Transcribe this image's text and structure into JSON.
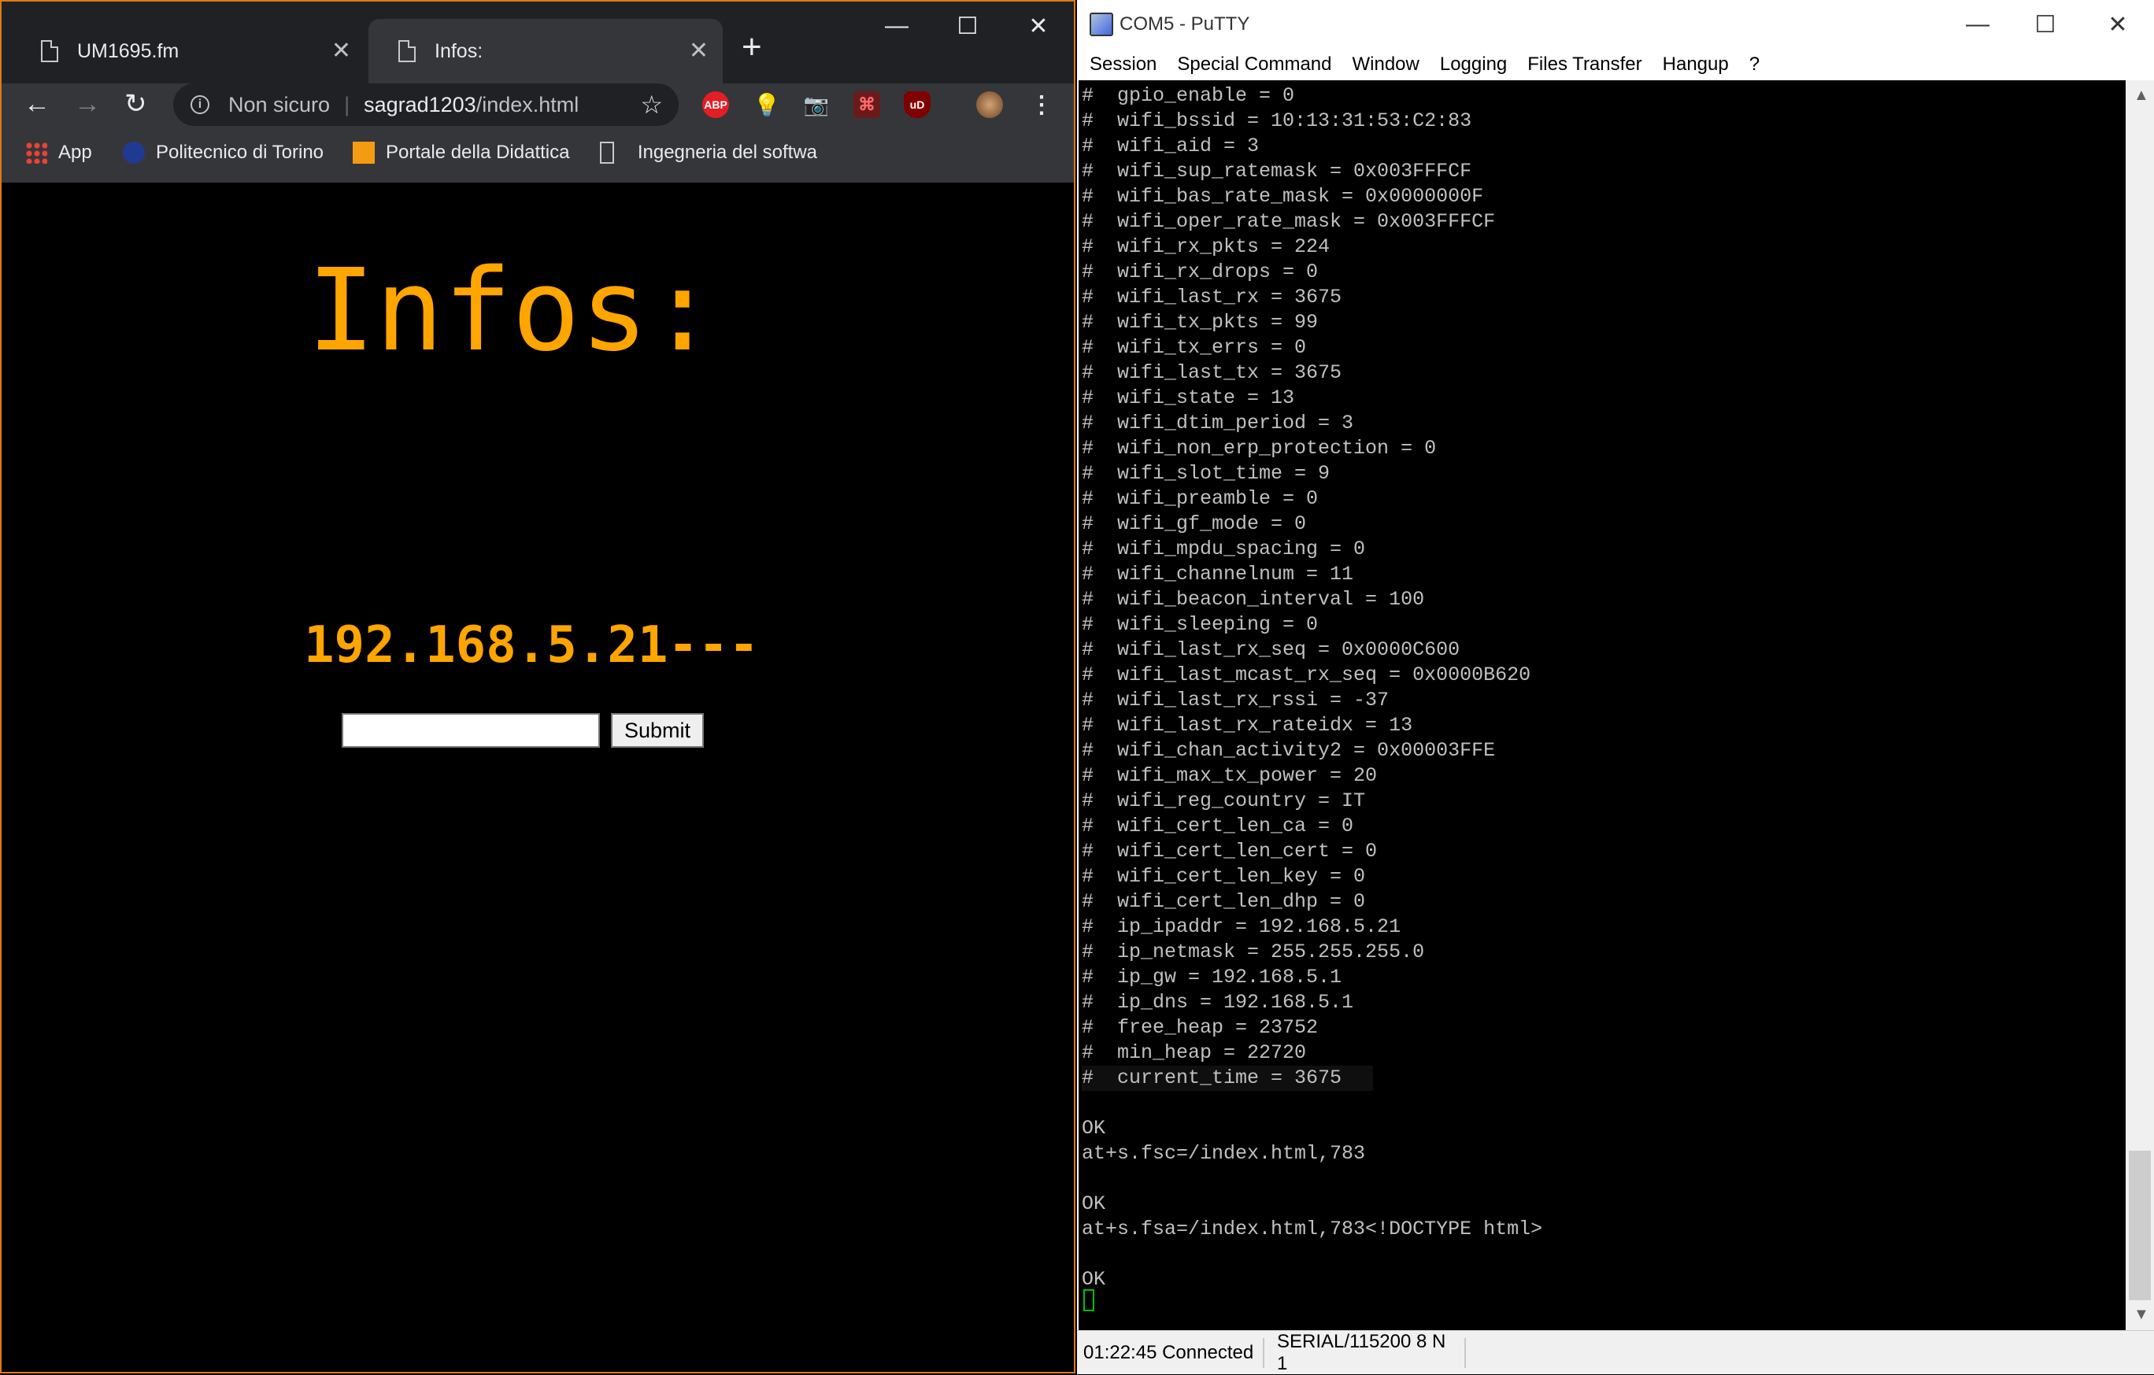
{
  "browser": {
    "tabs": [
      {
        "label": "UM1695.fm",
        "active": false
      },
      {
        "label": "Infos:",
        "active": true
      }
    ],
    "omnibox": {
      "security_label": "Non sicuro",
      "url_host": "sagrad1203",
      "url_path": "/index.html"
    },
    "extensions": [
      {
        "name": "adblock-plus-icon",
        "text": "ABP",
        "color": "#e31e24"
      },
      {
        "name": "lightbulb-icon",
        "text": "",
        "color": "#5f6368"
      },
      {
        "name": "camera-icon",
        "text": "",
        "color": "#5f6368"
      },
      {
        "name": "pdf-icon",
        "text": "",
        "color": "#c0392b"
      },
      {
        "name": "ublock-icon",
        "text": "uD",
        "color": "#800000"
      }
    ],
    "bookmarks": [
      {
        "label": "App",
        "icon": "apps-grid-icon"
      },
      {
        "label": "Politecnico di Torino",
        "icon": "polito-logo-icon"
      },
      {
        "label": "Portale della Didattica",
        "icon": "didattica-logo-icon"
      },
      {
        "label": "Ingegneria del softwa",
        "icon": "page-icon"
      }
    ],
    "page": {
      "title": "Infos:",
      "ip_text": "192.168.5.21---",
      "input_value": "",
      "submit_label": "Submit"
    }
  },
  "putty": {
    "title": "COM5 - PuTTY",
    "menu": [
      "Session",
      "Special Command",
      "Window",
      "Logging",
      "Files Transfer",
      "Hangup",
      "?"
    ],
    "terminal_lines": [
      "#  gpio_enable = 0",
      "#  wifi_bssid = 10:13:31:53:C2:83",
      "#  wifi_aid = 3",
      "#  wifi_sup_ratemask = 0x003FFFCF",
      "#  wifi_bas_rate_mask = 0x0000000F",
      "#  wifi_oper_rate_mask = 0x003FFFCF",
      "#  wifi_rx_pkts = 224",
      "#  wifi_rx_drops = 0",
      "#  wifi_last_rx = 3675",
      "#  wifi_tx_pkts = 99",
      "#  wifi_tx_errs = 0",
      "#  wifi_last_tx = 3675",
      "#  wifi_state = 13",
      "#  wifi_dtim_period = 3",
      "#  wifi_non_erp_protection = 0",
      "#  wifi_slot_time = 9",
      "#  wifi_preamble = 0",
      "#  wifi_gf_mode = 0",
      "#  wifi_mpdu_spacing = 0",
      "#  wifi_channelnum = 11",
      "#  wifi_beacon_interval = 100",
      "#  wifi_sleeping = 0",
      "#  wifi_last_rx_seq = 0x0000C600",
      "#  wifi_last_mcast_rx_seq = 0x0000B620",
      "#  wifi_last_rx_rssi = -37",
      "#  wifi_last_rx_rateidx = 13",
      "#  wifi_chan_activity2 = 0x00003FFE",
      "#  wifi_max_tx_power = 20",
      "#  wifi_reg_country = IT",
      "#  wifi_cert_len_ca = 0",
      "#  wifi_cert_len_cert = 0",
      "#  wifi_cert_len_key = 0",
      "#  wifi_cert_len_dhp = 0",
      "#  ip_ipaddr = 192.168.5.21",
      "#  ip_netmask = 255.255.255.0",
      "#  ip_gw = 192.168.5.1",
      "#  ip_dns = 192.168.5.1",
      "#  free_heap = 23752",
      "#  min_heap = 22720",
      "#  current_time = 3675",
      "",
      "OK",
      "at+s.fsc=/index.html,783",
      "",
      "OK",
      "at+s.fsa=/index.html,783<!DOCTYPE html>",
      "",
      "OK"
    ],
    "status": {
      "time_connected": "01:22:45 Connected",
      "serial": "SERIAL/115200 8 N 1"
    }
  },
  "colors": {
    "accent_orange": "#ffa500",
    "chrome_dark": "#202124",
    "chrome_toolbar": "#35363a",
    "window_border": "#e07a10",
    "cursor_green": "#00c000"
  }
}
